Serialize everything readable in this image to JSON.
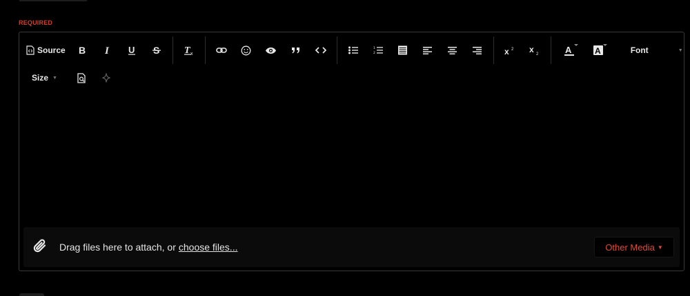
{
  "form": {
    "required_label": "REQUIRED"
  },
  "toolbar": {
    "source_label": "Source",
    "font_label": "Font",
    "size_label": "Size",
    "icons": [
      "source-icon",
      "bold-icon",
      "italic-icon",
      "underline-icon",
      "strikethrough-icon",
      "clear-formatting-icon",
      "link-icon",
      "emoji-icon",
      "preview-eye-icon",
      "quote-icon",
      "code-icon",
      "bullet-list-icon",
      "numbered-list-icon",
      "align-justify-icon",
      "align-left-icon",
      "align-center-icon",
      "align-right-icon",
      "superscript-icon",
      "subscript-icon",
      "text-color-icon",
      "background-color-icon",
      "draft-preview-icon",
      "sparkle-icon"
    ]
  },
  "attach": {
    "text": "Drag files here to attach, or",
    "link": "choose files...",
    "other_media_label": "Other Media",
    "other_media_caret": "▼"
  },
  "colors": {
    "required": "#c8402f",
    "accent": "#e2493a",
    "border": "#3a3a3a"
  }
}
